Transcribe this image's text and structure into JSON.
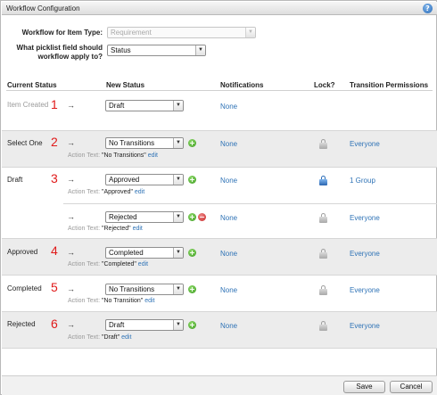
{
  "window": {
    "title": "Workflow Configuration"
  },
  "config": {
    "item_type_label": "Workflow for Item Type:",
    "item_type_value": "Requirement",
    "picklist_label_line1": "What picklist field should",
    "picklist_label_line2": "workflow apply to?",
    "picklist_value": "Status"
  },
  "headers": {
    "current_status": "Current Status",
    "new_status": "New Status",
    "notifications": "Notifications",
    "lock": "Lock?",
    "permissions": "Transition Permissions"
  },
  "arrow": "→",
  "action_text_label": "Action Text:",
  "edit_label": "edit",
  "rows": [
    {
      "current": "Item Created",
      "number": "1",
      "new_status": "Draft",
      "notifications": "None",
      "permissions": ""
    },
    {
      "current": "Select One",
      "number": "2",
      "new_status": "No Transitions",
      "action_text": "\"No Transitions\"",
      "notifications": "None",
      "permissions": "Everyone"
    },
    {
      "current": "Draft",
      "number": "3",
      "new_status": "Approved",
      "action_text": "\"Approved\"",
      "notifications": "None",
      "permissions": "1 Group"
    },
    {
      "current": "",
      "number": "",
      "new_status": "Rejected",
      "action_text": "\"Rejected\"",
      "notifications": "None",
      "permissions": "Everyone"
    },
    {
      "current": "Approved",
      "number": "4",
      "new_status": "Completed",
      "action_text": "\"Completed\"",
      "notifications": "None",
      "permissions": "Everyone"
    },
    {
      "current": "Completed",
      "number": "5",
      "new_status": "No Transitions",
      "action_text": "\"No Transition\"",
      "notifications": "None",
      "permissions": "Everyone"
    },
    {
      "current": "Rejected",
      "number": "6",
      "new_status": "Draft",
      "action_text": "\"Draft\"",
      "notifications": "None",
      "permissions": "Everyone"
    }
  ],
  "buttons": {
    "save": "Save",
    "cancel": "Cancel"
  },
  "colors": {
    "link": "#2f73b6",
    "step_number": "#e01a1a",
    "row_alt": "#ececec"
  }
}
